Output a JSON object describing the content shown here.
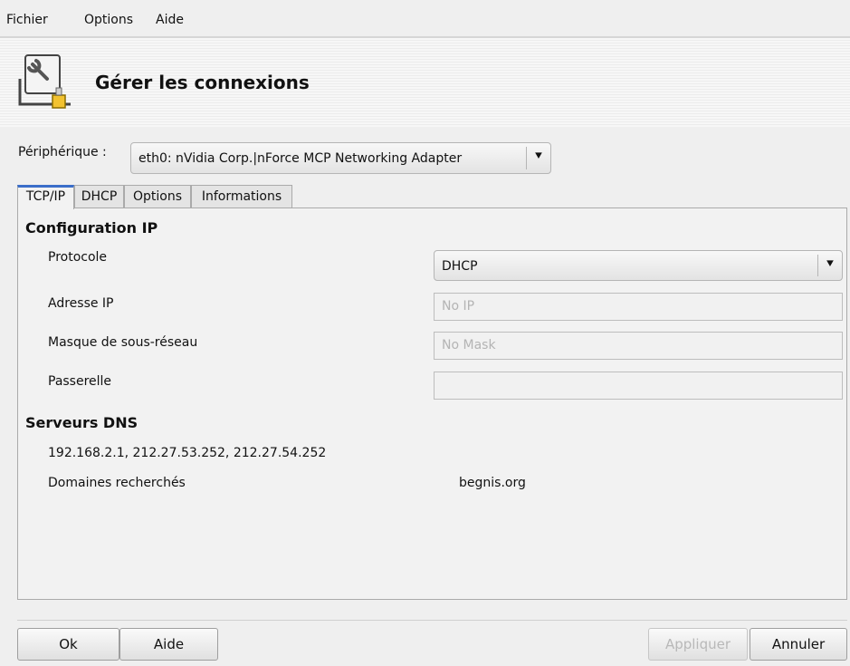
{
  "menu": [
    "Fichier",
    "Options",
    "Aide"
  ],
  "header": {
    "title": "Gérer les connexions",
    "icon": "network-tool-icon"
  },
  "device": {
    "label": "Périphérique :",
    "selected": "eth0: nVidia Corp.|nForce MCP Networking Adapter"
  },
  "tabs": [
    "TCP/IP",
    "DHCP",
    "Options",
    "Informations"
  ],
  "active_tab": "TCP/IP",
  "ip_config": {
    "heading": "Configuration IP",
    "protocol_label": "Protocole",
    "protocol_value": "DHCP",
    "ip_label": "Adresse IP",
    "ip_placeholder": "No IP",
    "mask_label": "Masque de sous-réseau",
    "mask_placeholder": "No Mask",
    "gateway_label": "Passerelle",
    "gateway_value": ""
  },
  "dns": {
    "heading": "Serveurs DNS",
    "servers": "192.168.2.1, 212.27.53.252, 212.27.54.252",
    "search_label": "Domaines recherchés",
    "search_value": "begnis.org"
  },
  "buttons": {
    "ok": "Ok",
    "help": "Aide",
    "apply": "Appliquer",
    "cancel": "Annuler"
  },
  "colors": {
    "active_tab_accent": "#3b6ec9",
    "background": "#efefef"
  }
}
